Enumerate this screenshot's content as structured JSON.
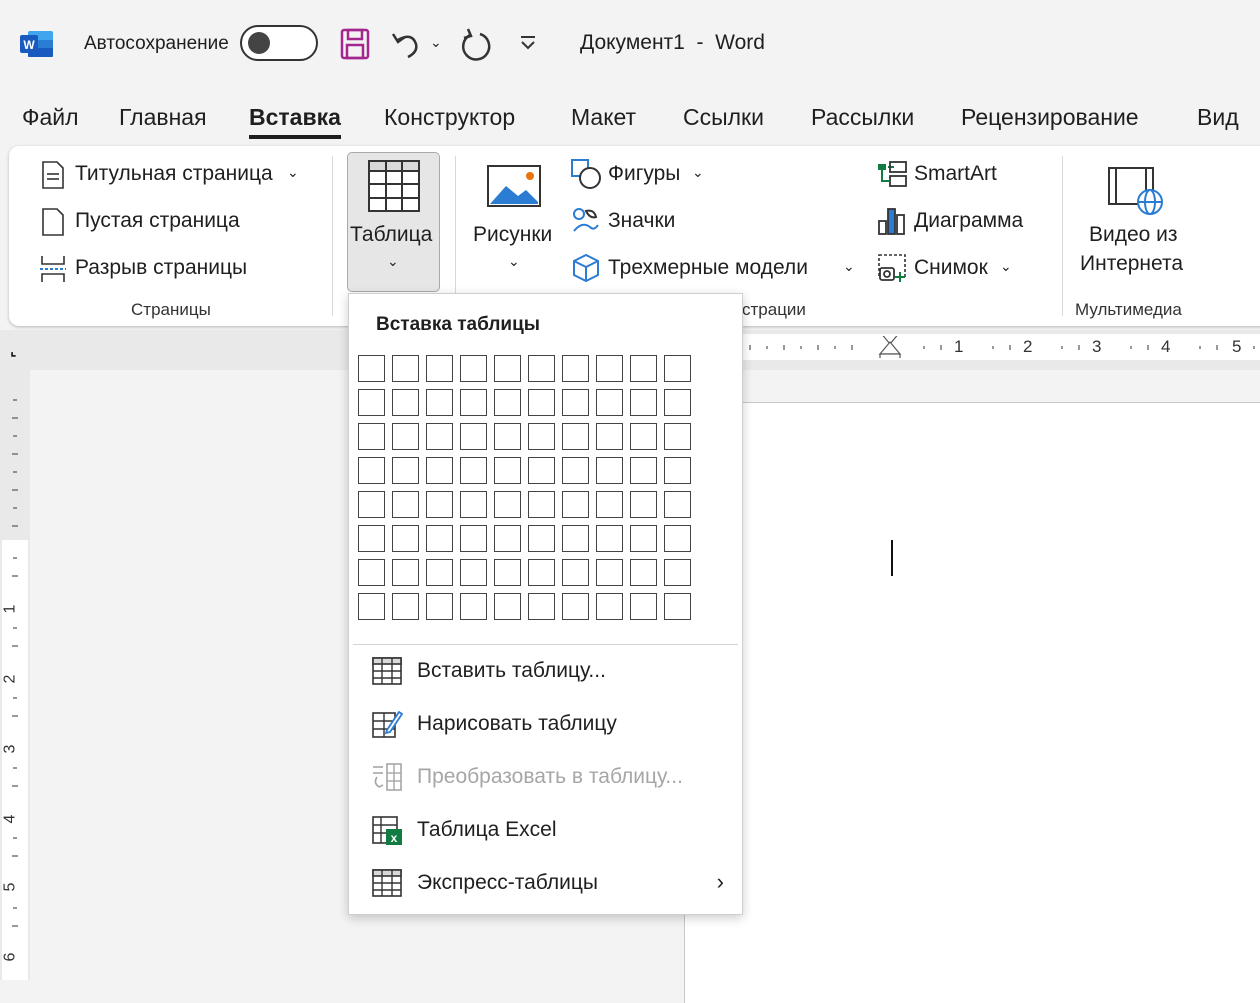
{
  "titlebar": {
    "autosave_label": "Автосохранение",
    "doc_title": "Документ1  -  Word"
  },
  "tabs": [
    {
      "label": "Файл"
    },
    {
      "label": "Главная"
    },
    {
      "label": "Вставка"
    },
    {
      "label": "Конструктор"
    },
    {
      "label": "Макет"
    },
    {
      "label": "Ссылки"
    },
    {
      "label": "Рассылки"
    },
    {
      "label": "Рецензирование"
    },
    {
      "label": "Вид"
    }
  ],
  "ribbon": {
    "pages": {
      "cover": "Титульная страница",
      "blank": "Пустая страница",
      "break": "Разрыв страницы",
      "group_label": "Страницы"
    },
    "table": {
      "label": "Таблица"
    },
    "pictures": {
      "label": "Рисунки"
    },
    "illustrations": {
      "shapes": "Фигуры",
      "icons": "Значки",
      "models3d": "Трехмерные модели",
      "smartart": "SmartArt",
      "chart": "Диаграмма",
      "screenshot": "Снимок",
      "group_label_partial": "страции"
    },
    "media": {
      "video_line1": "Видео из",
      "video_line2": "Интернета",
      "group_label": "Мультимедиа"
    }
  },
  "ruler": {
    "h_marks": [
      "1",
      "2",
      "3",
      "4",
      "5"
    ],
    "v_marks": [
      "1",
      "2",
      "3",
      "4",
      "5",
      "6"
    ]
  },
  "dropdown": {
    "title": "Вставка таблицы",
    "grid": {
      "columns": 10,
      "rows": 8
    },
    "items": [
      {
        "label": "Вставить таблицу...",
        "enabled": true
      },
      {
        "label": "Нарисовать таблицу",
        "enabled": true
      },
      {
        "label": "Преобразовать в таблицу...",
        "enabled": false
      },
      {
        "label": "Таблица Excel",
        "enabled": true
      },
      {
        "label": "Экспресс-таблицы",
        "enabled": true,
        "submenu": true
      }
    ]
  },
  "colors": {
    "word_blue": "#185abd",
    "save_purple": "#a3278f",
    "excel_green": "#107c41",
    "accent_blue": "#2b7cd3"
  }
}
